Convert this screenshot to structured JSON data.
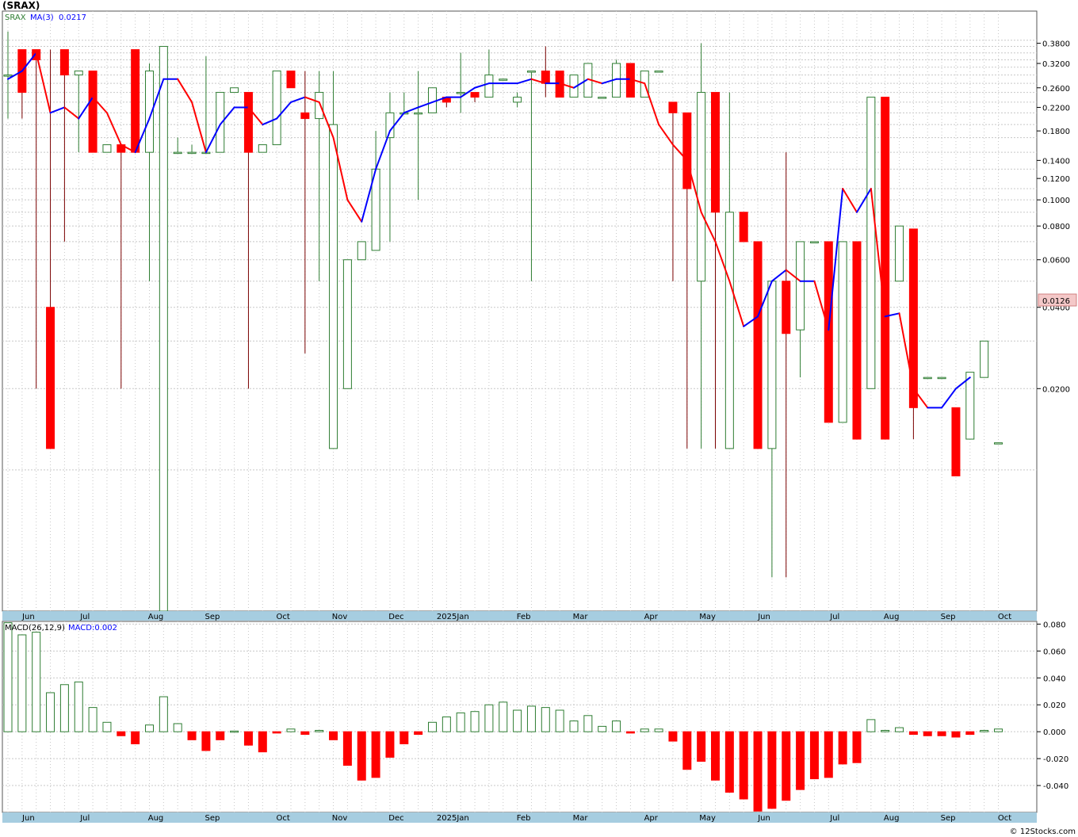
{
  "page": {
    "title": "(SRAX)",
    "watermark": "© 12Stocks.com"
  },
  "colors": {
    "up": "#2e7d32",
    "down": "#ff0000",
    "downWick": "#7a0000",
    "ma_up": "#0000ff",
    "ma_down": "#ff0000",
    "axisBand": "#a6cde0",
    "grid": "#c8c8c8",
    "priceTag": "#f4c8c8"
  },
  "chart_data": [
    {
      "type": "candlestick",
      "title": "(SRAX)",
      "scale": "log",
      "legend": {
        "symbol": "SRAX",
        "ma_label": "MA(3)",
        "ma_value": "0.0217"
      },
      "last_price_label": "0.0126",
      "ylim": [
        0.003,
        0.5
      ],
      "yticks": [
        0.38,
        0.32,
        0.26,
        0.22,
        0.18,
        0.14,
        0.12,
        0.1,
        0.08,
        0.06,
        0.04,
        0.02
      ],
      "ytick_labels": [
        "0.3800",
        "0.3200",
        "0.2600",
        "0.2200",
        "0.1800",
        "0.1400",
        "0.1200",
        "0.1000",
        "0.0800",
        "0.0600",
        "0.0400",
        "0.0200"
      ],
      "months": [
        "Jun",
        "Jul",
        "Aug",
        "Sep",
        "Oct",
        "Nov",
        "Dec",
        "2025Jan",
        "Feb",
        "Mar",
        "Apr",
        "May",
        "Jun",
        "Jul",
        "Aug",
        "Sep",
        "Oct"
      ],
      "month_index": [
        1,
        5,
        10,
        14,
        19,
        23,
        27,
        31,
        36,
        40,
        45,
        49,
        53,
        58,
        62,
        66,
        70
      ],
      "candles": [
        {
          "o": 0.29,
          "h": 0.42,
          "l": 0.2,
          "c": 0.29
        },
        {
          "o": 0.36,
          "h": 0.36,
          "l": 0.2,
          "c": 0.25
        },
        {
          "o": 0.36,
          "h": 0.36,
          "l": 0.02,
          "c": 0.33
        },
        {
          "o": 0.04,
          "h": 0.36,
          "l": 0.02,
          "c": 0.012
        },
        {
          "o": 0.36,
          "h": 0.36,
          "l": 0.07,
          "c": 0.29
        },
        {
          "o": 0.29,
          "h": 0.3,
          "l": 0.15,
          "c": 0.3
        },
        {
          "o": 0.3,
          "h": 0.3,
          "l": 0.15,
          "c": 0.15
        },
        {
          "o": 0.15,
          "h": 0.16,
          "l": 0.15,
          "c": 0.16
        },
        {
          "o": 0.16,
          "h": 0.16,
          "l": 0.02,
          "c": 0.15
        },
        {
          "o": 0.36,
          "h": 0.36,
          "l": 0.15,
          "c": 0.15
        },
        {
          "o": 0.15,
          "h": 0.32,
          "l": 0.05,
          "c": 0.3
        },
        {
          "o": 0.003,
          "h": 0.37,
          "l": 0.003,
          "c": 0.37
        },
        {
          "o": 0.15,
          "h": 0.17,
          "l": 0.15,
          "c": 0.15
        },
        {
          "o": 0.15,
          "h": 0.16,
          "l": 0.15,
          "c": 0.15
        },
        {
          "o": 0.15,
          "h": 0.34,
          "l": 0.15,
          "c": 0.15
        },
        {
          "o": 0.15,
          "h": 0.25,
          "l": 0.15,
          "c": 0.25
        },
        {
          "o": 0.25,
          "h": 0.26,
          "l": 0.25,
          "c": 0.26
        },
        {
          "o": 0.25,
          "h": 0.25,
          "l": 0.02,
          "c": 0.15
        },
        {
          "o": 0.15,
          "h": 0.16,
          "l": 0.15,
          "c": 0.16
        },
        {
          "o": 0.16,
          "h": 0.3,
          "l": 0.16,
          "c": 0.3
        },
        {
          "o": 0.3,
          "h": 0.3,
          "l": 0.26,
          "c": 0.26
        },
        {
          "o": 0.21,
          "h": 0.3,
          "l": 0.027,
          "c": 0.2
        },
        {
          "o": 0.2,
          "h": 0.3,
          "l": 0.05,
          "c": 0.25
        },
        {
          "o": 0.012,
          "h": 0.3,
          "l": 0.012,
          "c": 0.19
        },
        {
          "o": 0.02,
          "h": 0.06,
          "l": 0.02,
          "c": 0.06
        },
        {
          "o": 0.06,
          "h": 0.07,
          "l": 0.06,
          "c": 0.07
        },
        {
          "o": 0.065,
          "h": 0.18,
          "l": 0.065,
          "c": 0.13
        },
        {
          "o": 0.17,
          "h": 0.25,
          "l": 0.07,
          "c": 0.21
        },
        {
          "o": 0.21,
          "h": 0.25,
          "l": 0.21,
          "c": 0.21
        },
        {
          "o": 0.21,
          "h": 0.3,
          "l": 0.1,
          "c": 0.21
        },
        {
          "o": 0.21,
          "h": 0.26,
          "l": 0.21,
          "c": 0.26
        },
        {
          "o": 0.24,
          "h": 0.24,
          "l": 0.22,
          "c": 0.23
        },
        {
          "o": 0.25,
          "h": 0.35,
          "l": 0.21,
          "c": 0.25
        },
        {
          "o": 0.25,
          "h": 0.25,
          "l": 0.23,
          "c": 0.24
        },
        {
          "o": 0.24,
          "h": 0.36,
          "l": 0.24,
          "c": 0.29
        },
        {
          "o": 0.28,
          "h": 0.28,
          "l": 0.28,
          "c": 0.28
        },
        {
          "o": 0.23,
          "h": 0.25,
          "l": 0.22,
          "c": 0.24
        },
        {
          "o": 0.3,
          "h": 0.3,
          "l": 0.05,
          "c": 0.3
        },
        {
          "o": 0.3,
          "h": 0.37,
          "l": 0.24,
          "c": 0.27
        },
        {
          "o": 0.3,
          "h": 0.3,
          "l": 0.24,
          "c": 0.24
        },
        {
          "o": 0.24,
          "h": 0.29,
          "l": 0.24,
          "c": 0.29
        },
        {
          "o": 0.24,
          "h": 0.32,
          "l": 0.24,
          "c": 0.32
        },
        {
          "o": 0.24,
          "h": 0.24,
          "l": 0.24,
          "c": 0.24
        },
        {
          "o": 0.24,
          "h": 0.33,
          "l": 0.24,
          "c": 0.32
        },
        {
          "o": 0.32,
          "h": 0.32,
          "l": 0.24,
          "c": 0.24
        },
        {
          "o": 0.24,
          "h": 0.3,
          "l": 0.24,
          "c": 0.3
        },
        {
          "o": 0.3,
          "h": 0.3,
          "l": 0.3,
          "c": 0.3
        },
        {
          "o": 0.23,
          "h": 0.23,
          "l": 0.05,
          "c": 0.21
        },
        {
          "o": 0.21,
          "h": 0.21,
          "l": 0.012,
          "c": 0.11
        },
        {
          "o": 0.05,
          "h": 0.38,
          "l": 0.012,
          "c": 0.25
        },
        {
          "o": 0.25,
          "h": 0.25,
          "l": 0.012,
          "c": 0.09
        },
        {
          "o": 0.012,
          "h": 0.25,
          "l": 0.012,
          "c": 0.09
        },
        {
          "o": 0.09,
          "h": 0.09,
          "l": 0.07,
          "c": 0.07
        },
        {
          "o": 0.07,
          "h": 0.07,
          "l": 0.012,
          "c": 0.012
        },
        {
          "o": 0.012,
          "h": 0.05,
          "l": 0.004,
          "c": 0.05
        },
        {
          "o": 0.05,
          "h": 0.15,
          "l": 0.004,
          "c": 0.032
        },
        {
          "o": 0.033,
          "h": 0.07,
          "l": 0.022,
          "c": 0.07
        },
        {
          "o": 0.07,
          "h": 0.07,
          "l": 0.07,
          "c": 0.07
        },
        {
          "o": 0.07,
          "h": 0.07,
          "l": 0.015,
          "c": 0.015
        },
        {
          "o": 0.015,
          "h": 0.07,
          "l": 0.015,
          "c": 0.07
        },
        {
          "o": 0.07,
          "h": 0.07,
          "l": 0.013,
          "c": 0.013
        },
        {
          "o": 0.02,
          "h": 0.24,
          "l": 0.02,
          "c": 0.24
        },
        {
          "o": 0.24,
          "h": 0.24,
          "l": 0.013,
          "c": 0.013
        },
        {
          "o": 0.05,
          "h": 0.08,
          "l": 0.05,
          "c": 0.08
        },
        {
          "o": 0.078,
          "h": 0.078,
          "l": 0.013,
          "c": 0.017
        },
        {
          "o": 0.022,
          "h": 0.022,
          "l": 0.022,
          "c": 0.022
        },
        {
          "o": 0.022,
          "h": 0.022,
          "l": 0.022,
          "c": 0.022
        },
        {
          "o": 0.017,
          "h": 0.017,
          "l": 0.0095,
          "c": 0.0095
        },
        {
          "o": 0.013,
          "h": 0.023,
          "l": 0.013,
          "c": 0.023
        },
        {
          "o": 0.022,
          "h": 0.03,
          "l": 0.022,
          "c": 0.03
        },
        {
          "o": 0.0126,
          "h": 0.0126,
          "l": 0.0126,
          "c": 0.0126
        }
      ],
      "ma": [
        0.28,
        0.3,
        0.35,
        0.21,
        0.22,
        0.2,
        0.24,
        0.21,
        0.16,
        0.15,
        0.2,
        0.28,
        0.28,
        0.23,
        0.15,
        0.19,
        0.22,
        0.22,
        0.19,
        0.2,
        0.23,
        0.24,
        0.23,
        0.17,
        0.1,
        0.083,
        0.13,
        0.18,
        0.21,
        0.22,
        0.23,
        0.24,
        0.24,
        0.26,
        0.27,
        0.27,
        0.27,
        0.28,
        0.27,
        0.27,
        0.26,
        0.28,
        0.27,
        0.28,
        0.28,
        0.27,
        0.19,
        0.16,
        0.14,
        0.09,
        0.07,
        0.05,
        0.034,
        0.037,
        0.05,
        0.055,
        0.05,
        0.05,
        0.033,
        0.11,
        0.09,
        0.11,
        0.037,
        0.038,
        0.02,
        0.017,
        0.017,
        0.02,
        0.022
      ]
    },
    {
      "type": "bar",
      "title": "MACD",
      "legend": {
        "label": "MACD(26,12,9)",
        "value_label": "MACD:0.002"
      },
      "ylim": [
        -0.06,
        0.082
      ],
      "yticks": [
        0.08,
        0.06,
        0.04,
        0.02,
        0.0,
        -0.02,
        -0.04
      ],
      "ytick_labels": [
        "0.080",
        "0.060",
        "0.040",
        "0.020",
        "0.000",
        "-0.020",
        "-0.040"
      ],
      "months": [
        "Jun",
        "Jul",
        "Aug",
        "Sep",
        "Oct",
        "Nov",
        "Dec",
        "2025Jan",
        "Feb",
        "Mar",
        "Apr",
        "May",
        "Jun",
        "Jul",
        "Aug",
        "Sep",
        "Oct"
      ],
      "values": [
        0.081,
        0.072,
        0.074,
        0.029,
        0.035,
        0.037,
        0.018,
        0.007,
        -0.003,
        -0.009,
        0.005,
        0.026,
        0.006,
        -0.006,
        -0.014,
        -0.006,
        0.0005,
        -0.01,
        -0.015,
        -0.001,
        0.002,
        -0.002,
        0.001,
        -0.006,
        -0.025,
        -0.036,
        -0.034,
        -0.019,
        -0.009,
        -0.002,
        0.007,
        0.011,
        0.014,
        0.015,
        0.02,
        0.022,
        0.016,
        0.019,
        0.018,
        0.016,
        0.008,
        0.012,
        0.004,
        0.008,
        -0.001,
        0.002,
        0.002,
        -0.007,
        -0.028,
        -0.022,
        -0.036,
        -0.045,
        -0.05,
        -0.059,
        -0.057,
        -0.051,
        -0.043,
        -0.035,
        -0.034,
        -0.024,
        -0.023,
        0.009,
        0.001,
        0.003,
        -0.002,
        -0.003,
        -0.003,
        -0.004,
        -0.002,
        0.001,
        0.002
      ]
    }
  ]
}
